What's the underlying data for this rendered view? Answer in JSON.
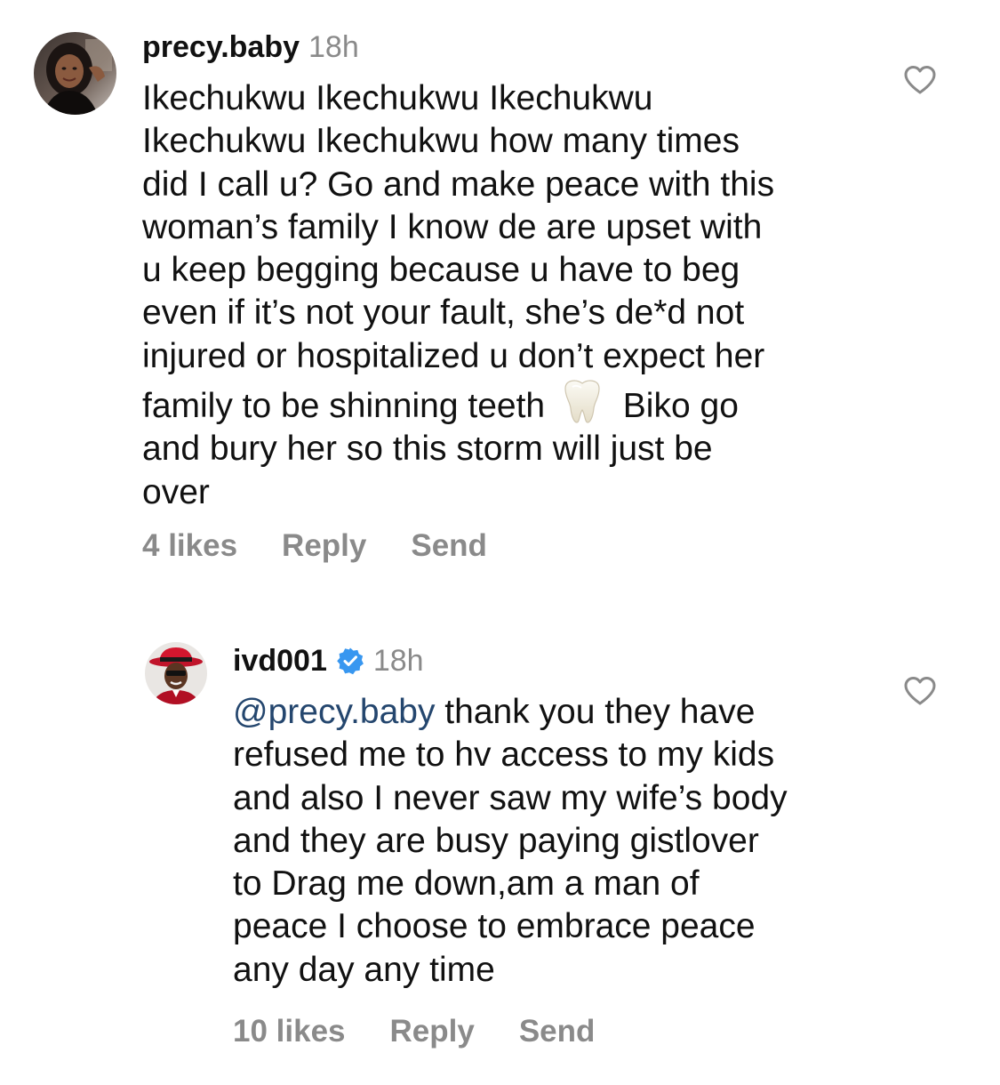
{
  "comments": [
    {
      "username": "precy.baby",
      "time": "18h",
      "verified": false,
      "lines": [
        "Ikechukwu Ikechukwu Ikechukwu",
        "Ikechukwu Ikechukwu how many times",
        "did I call u? Go and make peace with this",
        "woman’s family I know de are upset with",
        "u keep begging because u have to beg",
        "even if it’s not your fault, she’s de*d not",
        "injured or hospitalized u don’t expect her"
      ],
      "line_with_emoji": {
        "before": "family to be shinning teeth",
        "emoji": "tooth-emoji",
        "after": "Biko go"
      },
      "lines_after": [
        "and bury her so this storm will just be",
        "over"
      ],
      "likes": "4 likes",
      "reply": "Reply",
      "send": "Send"
    },
    {
      "username": "ivd001",
      "time": "18h",
      "verified": true,
      "mention": "@precy.baby",
      "first_line_rest": " thank you they have",
      "lines": [
        "refused me to hv access to my kids",
        "and also I never saw my wife’s body",
        "and they are busy paying gistlover",
        "to Drag me down,am a man of",
        "peace I choose to embrace peace",
        "any day any time"
      ],
      "likes": "10 likes",
      "reply": "Reply",
      "send": "Send"
    }
  ],
  "colors": {
    "text": "#111111",
    "muted": "#8a8a8a",
    "mention": "#24466e",
    "verified": "#3897f0"
  }
}
